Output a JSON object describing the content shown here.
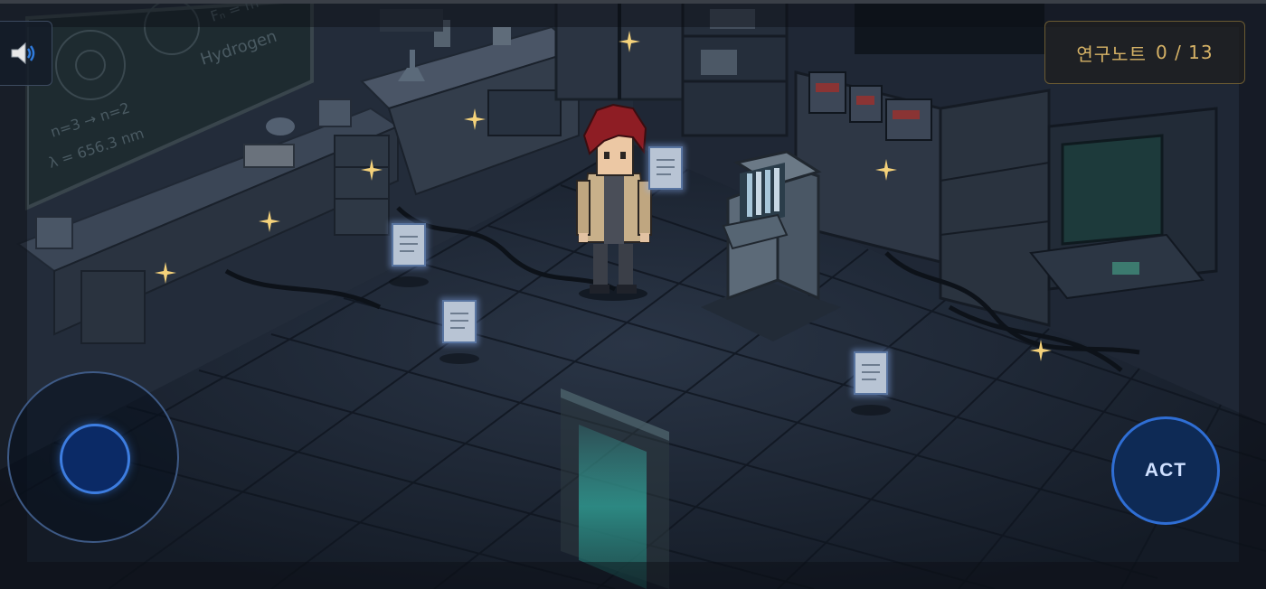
{
  "hud": {
    "sound_icon": "speaker-volume-icon",
    "notes_label": "연구노트",
    "notes_count": "0 / 13",
    "act_label": "ACT"
  },
  "board": {
    "line1": "Fₙ = m",
    "line2": "Hydrogen",
    "line3": "n=3 → n=2",
    "line4": "λ = 656.3 nm"
  },
  "colors": {
    "hud_gold": "#d6b266",
    "act_blue": "#2f6ed4",
    "sparkle": "#f5d27a",
    "note_glow": "#8fb6ff"
  }
}
